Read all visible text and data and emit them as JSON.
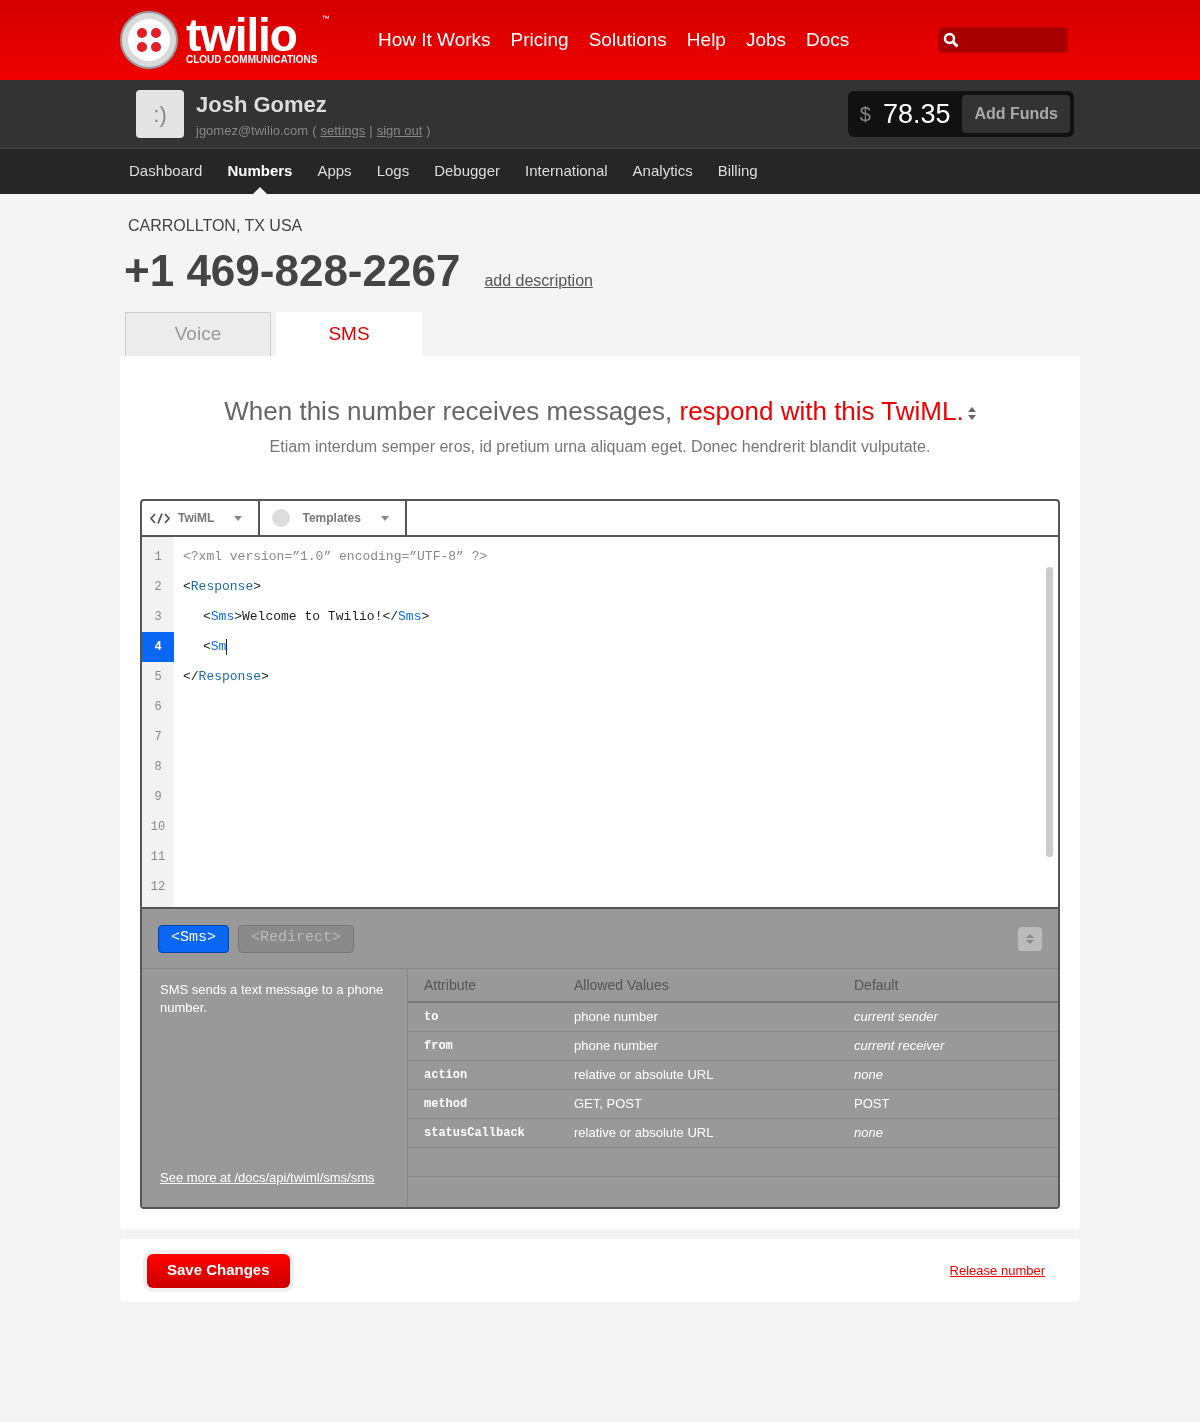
{
  "brand": {
    "name": "twilio",
    "tagline": "CLOUD COMMUNICATIONS",
    "trademark": "™"
  },
  "top_nav": [
    "How It Works",
    "Pricing",
    "Solutions",
    "Help",
    "Jobs",
    "Docs"
  ],
  "account": {
    "avatar": ":)",
    "name": "Josh Gomez",
    "email": "jgomez@twilio.com",
    "open_paren": "(",
    "settings": "settings",
    "separator": "|",
    "sign_out": "sign out",
    "close_paren": ")",
    "currency": "$",
    "balance": "78.35",
    "add_funds": "Add Funds"
  },
  "sub_nav": [
    {
      "label": "Dashboard",
      "selected": false
    },
    {
      "label": "Numbers",
      "selected": true
    },
    {
      "label": "Apps",
      "selected": false
    },
    {
      "label": "Logs",
      "selected": false
    },
    {
      "label": "Debugger",
      "selected": false
    },
    {
      "label": "International",
      "selected": false
    },
    {
      "label": "Analytics",
      "selected": false
    },
    {
      "label": "Billing",
      "selected": false
    }
  ],
  "number": {
    "location": "CARROLLTON, TX USA",
    "phone": "+1 469-828-2267",
    "add_description": "add description"
  },
  "tabs": [
    {
      "label": "Voice",
      "selected": false
    },
    {
      "label": "SMS",
      "selected": true
    }
  ],
  "heading": {
    "text": "When this number receives messages,",
    "action": "respond with this TwiML."
  },
  "subheading": "Etiam interdum semper eros, id pretium urna aliquam eget. Donec hendrerit blandit vulputate.",
  "editor": {
    "toolbar": [
      {
        "kind": "code",
        "label": "TwiML"
      },
      {
        "kind": "templates",
        "label": "Templates"
      }
    ],
    "lines": [
      {
        "number": "1",
        "selected": false,
        "tokens": [
          {
            "kind": "decl",
            "text": "<?xml version=”1.0” encoding=”UTF-8” ?>"
          }
        ]
      },
      {
        "number": "2",
        "selected": false,
        "tokens": [
          {
            "kind": "punct",
            "text": "<"
          },
          {
            "kind": "tag",
            "text": "Response"
          },
          {
            "kind": "punct",
            "text": ">"
          }
        ]
      },
      {
        "number": "3",
        "selected": false,
        "tokens": [
          {
            "kind": "indent"
          },
          {
            "kind": "punct",
            "text": "<"
          },
          {
            "kind": "sms",
            "text": "Sms"
          },
          {
            "kind": "punct",
            "text": ">Welcome to Twilio!</"
          },
          {
            "kind": "sms",
            "text": "Sms"
          },
          {
            "kind": "punct",
            "text": ">"
          }
        ]
      },
      {
        "number": "4",
        "selected": true,
        "tokens": [
          {
            "kind": "indent"
          },
          {
            "kind": "punct",
            "text": "<"
          },
          {
            "kind": "sms",
            "text": "Sm"
          }
        ]
      },
      {
        "number": "5",
        "selected": false,
        "tokens": [
          {
            "kind": "punct",
            "text": "</"
          },
          {
            "kind": "tag",
            "text": "Response"
          },
          {
            "kind": "punct",
            "text": ">"
          }
        ]
      },
      {
        "number": "6",
        "selected": false
      },
      {
        "number": "7",
        "selected": false
      },
      {
        "number": "8",
        "selected": false
      },
      {
        "number": "9",
        "selected": false
      },
      {
        "number": "10",
        "selected": false
      },
      {
        "number": "11",
        "selected": false
      },
      {
        "number": "12",
        "selected": false
      }
    ]
  },
  "helper": {
    "tags": [
      {
        "label": "<Sms>",
        "selected": true
      },
      {
        "label": "<Redirect>",
        "selected": false
      }
    ],
    "description": "SMS sends a text message to a phone number.",
    "more_link": "See more at /docs/api/twiml/sms/sms",
    "columns": [
      "Attribute",
      "Allowed Values",
      "Default"
    ],
    "rows": [
      {
        "attribute": "to",
        "allowed": "phone number",
        "default": "current sender",
        "default_italic": true
      },
      {
        "attribute": "from",
        "allowed": "phone number",
        "default": "current receiver",
        "default_italic": true
      },
      {
        "attribute": "action",
        "allowed": "relative or absolute URL",
        "default": "none",
        "default_italic": true
      },
      {
        "attribute": "method",
        "allowed": "GET, POST",
        "default": "POST",
        "default_italic": false
      },
      {
        "attribute": "statusCallback",
        "allowed": "relative or absolute URL",
        "default": "none",
        "default_italic": true
      }
    ]
  },
  "footer": {
    "save": "Save Changes",
    "release": "Release number"
  }
}
